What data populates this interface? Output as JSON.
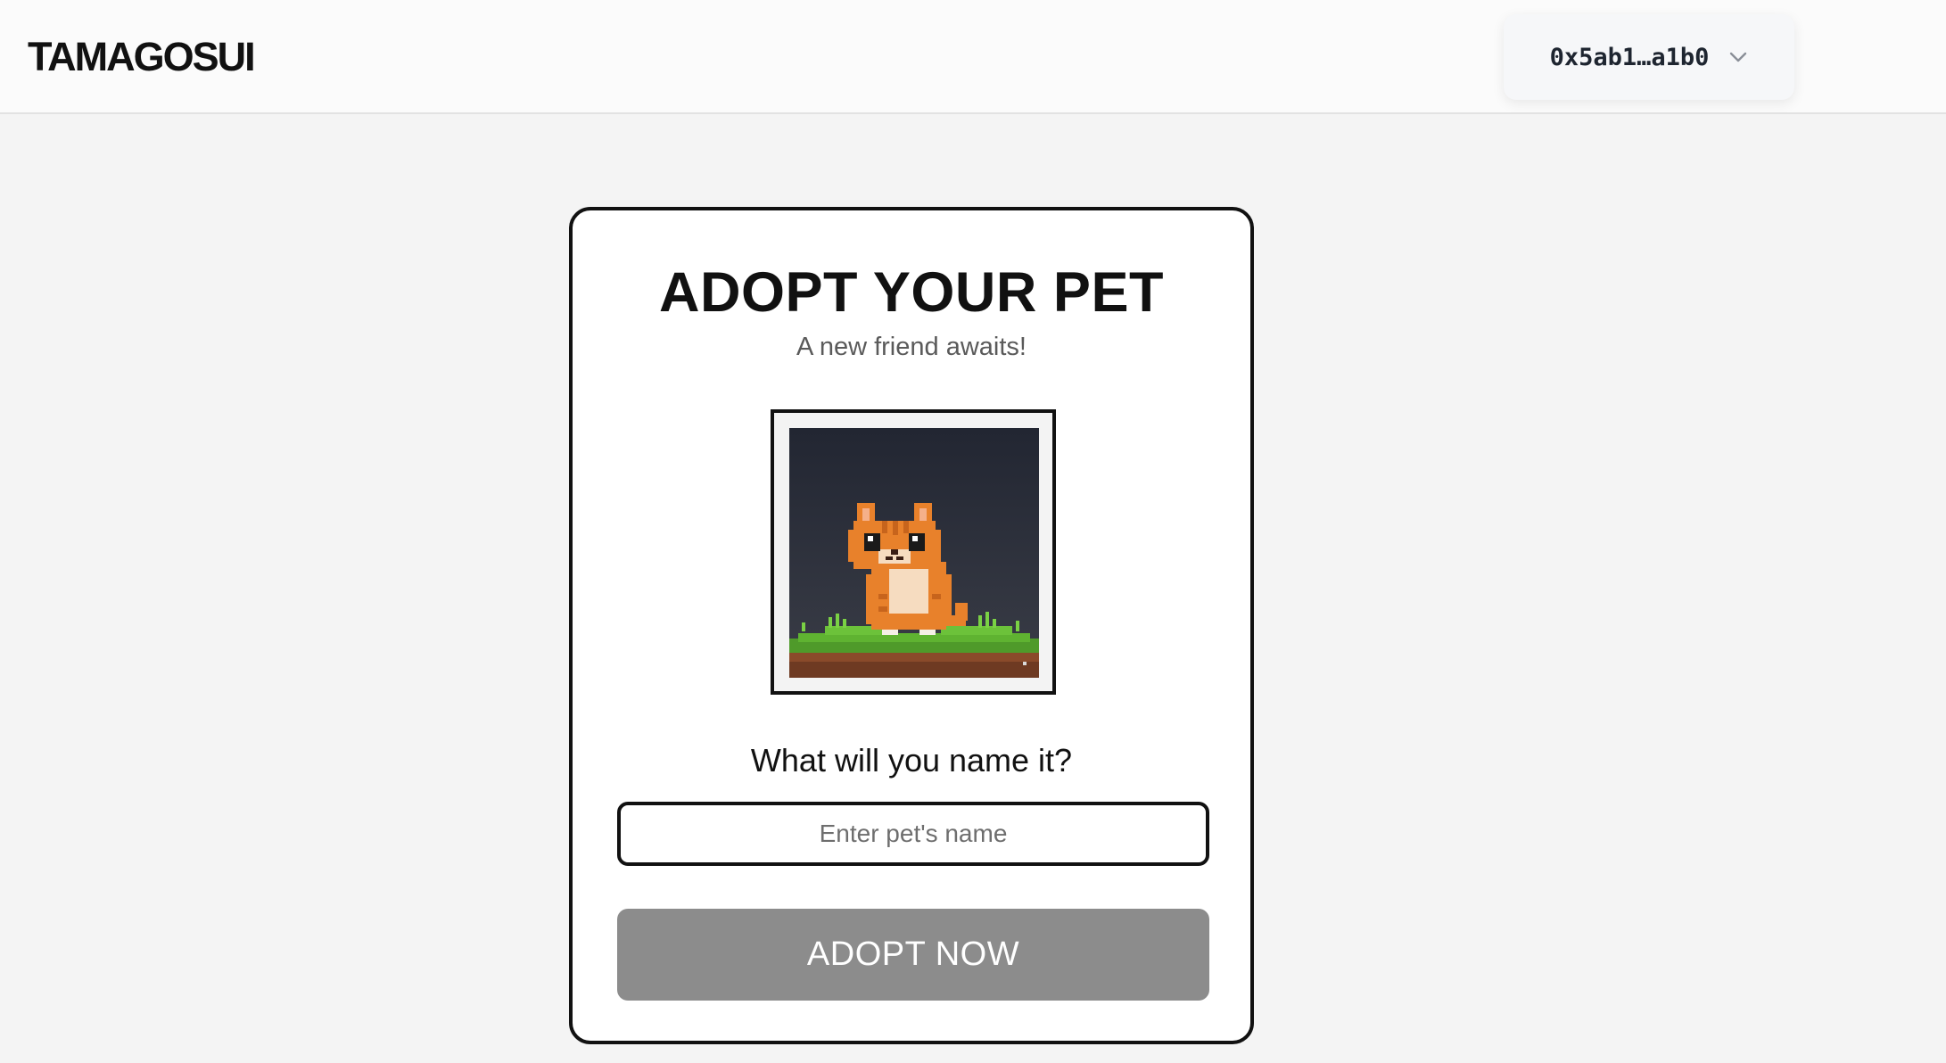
{
  "header": {
    "logo": "TAMAGOSUI",
    "wallet": {
      "address": "0x5ab1…a1b0",
      "chevron_icon": "chevron-down-icon"
    }
  },
  "adopt_card": {
    "title": "ADOPT YOUR PET",
    "subtitle": "A new friend awaits!",
    "pet_image": {
      "icon": "pixel-orange-cat-icon"
    },
    "name_prompt": "What will you name it?",
    "name_input": {
      "value": "",
      "placeholder": "Enter pet's name"
    },
    "adopt_button": {
      "label": "ADOPT NOW",
      "state": "disabled"
    }
  },
  "colors": {
    "page_background": "#f4f4f4",
    "header_background": "#fbfbfb",
    "card_border": "#111111",
    "button_disabled": "#8c8c8c",
    "pet_background": "#222632",
    "cat_orange": "#e8812b"
  }
}
